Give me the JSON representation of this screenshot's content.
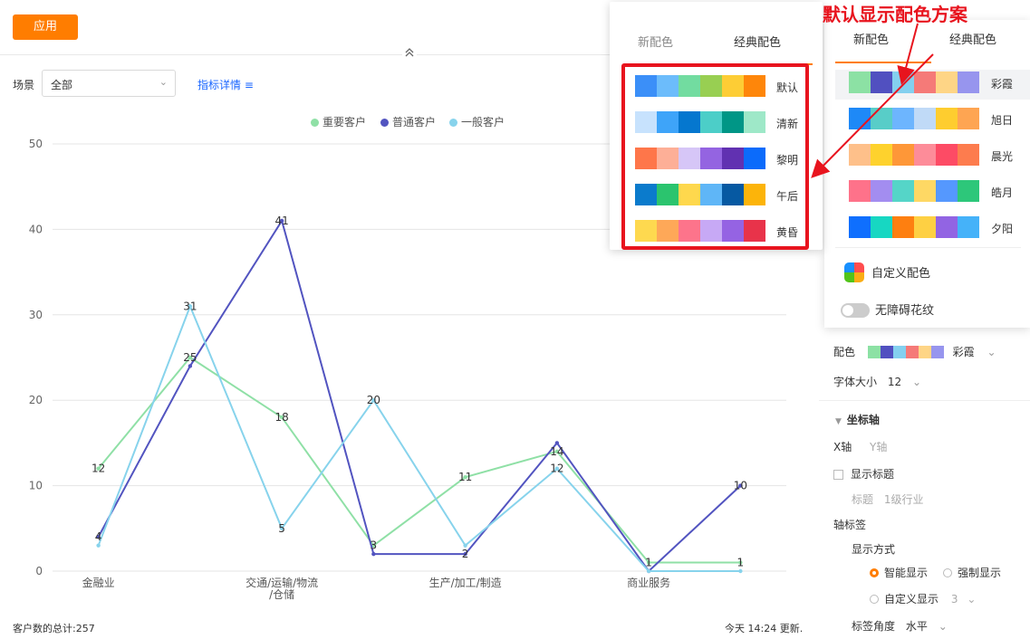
{
  "toolbar": {
    "apply_label": "应用",
    "collapse_icon": "double-chevron-up-icon"
  },
  "filters": {
    "scene_label": "场景",
    "scene_value": "全部",
    "metric_link_label": "指标详情",
    "metric_link_icon": "list-icon"
  },
  "chart_data": {
    "type": "line",
    "categories": [
      "金融业",
      "",
      "交通/运输/物流/仓储",
      "",
      "生产/加工/制造",
      "",
      "商业服务",
      ""
    ],
    "x_tick_labels": [
      "金融业",
      "交通/运输/物流",
      "/仓储",
      "生产/加工/制造",
      "商业服务"
    ],
    "series": [
      {
        "name": "重要客户",
        "color": "#8fe0a6",
        "values": [
          12,
          25,
          18,
          3,
          11,
          14,
          1,
          1
        ]
      },
      {
        "name": "普通客户",
        "color": "#5254c0",
        "values": [
          4,
          24,
          41,
          2,
          2,
          15,
          0,
          10
        ]
      },
      {
        "name": "一般客户",
        "color": "#87d3ec",
        "values": [
          3,
          31,
          5,
          20,
          3,
          12,
          0,
          0
        ]
      }
    ],
    "data_labels": [
      {
        "series": 0,
        "index": 0,
        "text": "12"
      },
      {
        "series": 0,
        "index": 1,
        "text": "25"
      },
      {
        "series": 0,
        "index": 2,
        "text": "18"
      },
      {
        "series": 0,
        "index": 3,
        "text": "3"
      },
      {
        "series": 0,
        "index": 4,
        "text": "11"
      },
      {
        "series": 0,
        "index": 5,
        "text": "14"
      },
      {
        "series": 0,
        "index": 6,
        "text": "1"
      },
      {
        "series": 0,
        "index": 7,
        "text": "1"
      },
      {
        "series": 1,
        "index": 0,
        "text": "4"
      },
      {
        "series": 1,
        "index": 2,
        "text": "41"
      },
      {
        "series": 1,
        "index": 4,
        "text": "2"
      },
      {
        "series": 1,
        "index": 7,
        "text": "10"
      },
      {
        "series": 2,
        "index": 1,
        "text": "31"
      },
      {
        "series": 2,
        "index": 2,
        "text": "5"
      },
      {
        "series": 2,
        "index": 3,
        "text": "20"
      },
      {
        "series": 2,
        "index": 5,
        "text": "12"
      }
    ],
    "y_ticks": [
      0,
      10,
      20,
      30,
      40,
      50
    ],
    "ylim": [
      0,
      50
    ],
    "grid": true,
    "legend_position": "top-center"
  },
  "footer": {
    "total": "客户数的总计:257",
    "update": "今天 14:24 更新."
  },
  "popup_classic": {
    "tab_new": "新配色",
    "tab_classic": "经典配色",
    "schemes": [
      {
        "name": "默认",
        "colors": [
          "#3b8ff8",
          "#6cbcfb",
          "#72dca0",
          "#98cf52",
          "#fdcd35",
          "#fe860a"
        ]
      },
      {
        "name": "清新",
        "colors": [
          "#c7e2fd",
          "#3ea4f9",
          "#0577cf",
          "#4ccec8",
          "#009686",
          "#9ee8c8"
        ]
      },
      {
        "name": "黎明",
        "colors": [
          "#fe764a",
          "#fdaf97",
          "#d6c6f7",
          "#9464e1",
          "#6131b1",
          "#0b6bfb"
        ]
      },
      {
        "name": "午后",
        "colors": [
          "#0b7bcc",
          "#2bc46e",
          "#fed84d",
          "#5fb6f7",
          "#0659a2",
          "#fcb40a"
        ]
      },
      {
        "name": "黄昏",
        "colors": [
          "#fed94f",
          "#fea858",
          "#fd748b",
          "#c7a9f5",
          "#9563e3",
          "#e8334a"
        ]
      }
    ]
  },
  "popup_new": {
    "tab_new": "新配色",
    "tab_classic": "经典配色",
    "schemes": [
      {
        "name": "彩霞",
        "colors": [
          "#8ce1a4",
          "#5150c0",
          "#84d0ef",
          "#f57a78",
          "#fed586",
          "#9795ee"
        ]
      },
      {
        "name": "旭日",
        "colors": [
          "#1e89f7",
          "#58cdc8",
          "#6db5fe",
          "#c0daf7",
          "#fecd2f",
          "#fea552"
        ]
      },
      {
        "name": "晨光",
        "colors": [
          "#fec08a",
          "#fed22d",
          "#fe9738",
          "#fd8c99",
          "#fd4b65",
          "#fd7c4e"
        ]
      },
      {
        "name": "皓月",
        "colors": [
          "#fe728a",
          "#a38df0",
          "#55d5c8",
          "#fed864",
          "#5598fe",
          "#2dc77a"
        ]
      },
      {
        "name": "夕阳",
        "colors": [
          "#0f6ffe",
          "#17d7c2",
          "#fe7f10",
          "#fed043",
          "#9264e3",
          "#45b2f9"
        ]
      }
    ],
    "custom_label": "自定义配色",
    "barrier_free_label": "无障碍花纹"
  },
  "annotation": "默认显示配色方案",
  "settings": {
    "color_label": "配色",
    "color_value": "彩霞",
    "color_swatches": [
      "#8ce1a4",
      "#5150c0",
      "#84d0ef",
      "#f57a78",
      "#fed586",
      "#9795ee"
    ],
    "font_size_label": "字体大小",
    "font_size_value": "12",
    "axis_section": "坐标轴",
    "x_axis_tab": "X轴",
    "y_axis_tab": "Y轴",
    "show_title_label": "显示标题",
    "title_label": "标题",
    "title_value": "1级行业",
    "axis_label_section": "轴标签",
    "display_mode_label": "显示方式",
    "smart_display": "智能显示",
    "force_display": "强制显示",
    "custom_display": "自定义显示",
    "custom_display_value": "3",
    "label_angle_label": "标签角度",
    "label_angle_value": "水平"
  }
}
